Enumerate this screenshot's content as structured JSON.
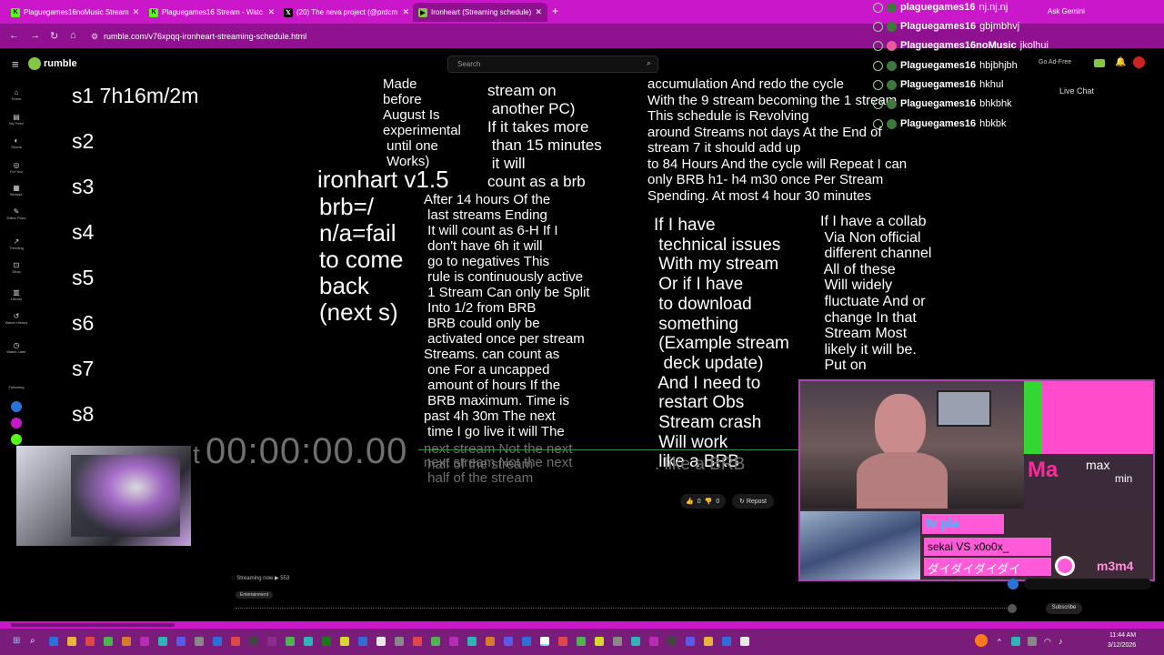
{
  "tabs": [
    {
      "label": "Plaguegames16noMusic Stream"
    },
    {
      "label": "Plaguegames16 Stream - Watc"
    },
    {
      "label": "(20) The neva project (@prdcm"
    },
    {
      "label": "Ironheart (Streaming schedule)"
    }
  ],
  "address": {
    "url": "rumble.com/v76xpqq-ironheart-streaming-schedule.html"
  },
  "rumble": {
    "logo": "rumble",
    "search_placeholder": "Search",
    "live_chat": "Live Chat",
    "ad_free": "Go Ad-Free"
  },
  "sidebar": {
    "items": [
      "Home",
      "My Feed",
      "Shorts",
      "For You",
      "Browse",
      "Editor Picks",
      "Trending",
      "Shop",
      "Library",
      "Watch History",
      "Watch Later"
    ],
    "following": "Following"
  },
  "schedule": {
    "rows": [
      "s1 7h16m/2m",
      "s2",
      "s3",
      "s4",
      "s5",
      "s6",
      "s7",
      "s8"
    ],
    "col1": "Made\nbefore\nAugust Is\nexperimental\n until one\n Works)",
    "title": "ironhart v1.5",
    "legend": "brb=/\nn/a=fail\nto come\nback\n(next s)",
    "col2a": "stream on\n another PC)\nIf it takes more\n than 15 minutes\n it will\ncount as a brb",
    "col2b": "After 14 hours Of the\n last streams Ending\n It will count as 6-H If I\n don't have 6h it will\n go to negatives This\n rule is continuously active\n 1 Stream Can only be Split\n Into 1/2 from BRB\n BRB could only be\n activated once per stream\nStreams. can count as\n one For a uncapped\n amount of hours If the\n BRB maximum. Time is\npast 4h 30m The next\n time I go live it will The\n",
    "col2c": "next stream Not the next\n half of the stream",
    "col3a": "accumulation And redo the cycle\nWith the 9 stream becoming the 1 stream\nThis schedule is Revolving\naround Streams not days At the End of\nstream 7 it should add up\nto 84 Hours And the cycle will Repeat I can\nonly BRB h1- h4 m30 once Per Stream\nSpending. At most 4 hour 30 minutes",
    "col3b": "If I have\n technical issues\n With my stream\n Or if I have\n to download\n something\n (Example stream\n  deck update)\n And I need to\n restart Obs\n Stream crash\n Will work\n like a BRB",
    "col4": "If I have a collab\n Via Non official\n different channel\n All of these\n Will widely\n fluctuate And or\n change In that\n Stream Most\n likely it will be.\n Put on",
    "timer": "00:00:00.00",
    "timer_prefix": "t"
  },
  "webcam": {
    "max": "max",
    "min": "min",
    "now_playing": "sekai VS x0o0x_",
    "lyric": "ダイダイダイダイ",
    "tag": "m3m4",
    "brand": "Ma"
  },
  "chat": [
    {
      "user": "plaguegames16",
      "msg": "nj.nj.nj"
    },
    {
      "user": "Plaguegames16",
      "msg": "gbjmbhvj"
    },
    {
      "user": "Plaguegames16noMusic",
      "msg": "jkolhui"
    },
    {
      "user": "Plaguegames16",
      "msg": "hbjbhjbh"
    },
    {
      "user": "Plaguegames16",
      "msg": "hkhul"
    },
    {
      "user": "Plaguegames16",
      "msg": "bhkbhk"
    },
    {
      "user": "Plaguegames16",
      "msg": "hbkbk"
    }
  ],
  "video": {
    "likes": "0",
    "dislikes": "0",
    "repost": "Repost",
    "streaming_now": "Streaming now",
    "viewers": "553",
    "category": "Entertainment",
    "subscribe": "Subscribe",
    "ask": "Ask Gemini"
  },
  "taskbar": {
    "time": "11:44 AM",
    "date": "3/12/2026"
  },
  "colors": {
    "chrome": "#c917c9",
    "accent": "#85c742",
    "overlay_border": "#b043b0"
  }
}
